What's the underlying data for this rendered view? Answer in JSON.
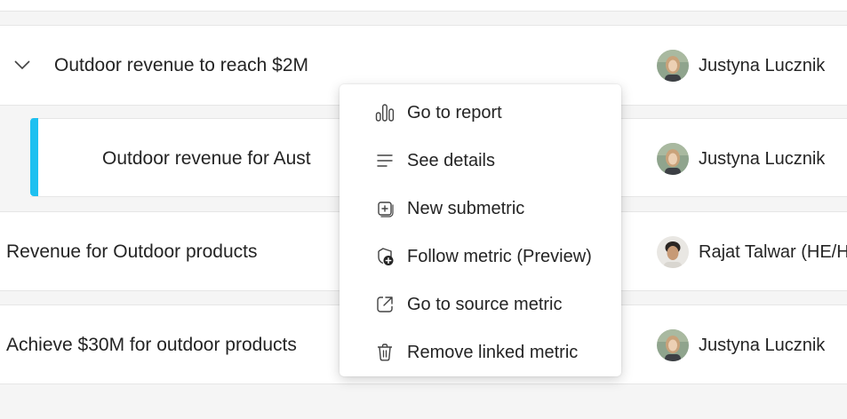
{
  "metrics": [
    {
      "name": "Outdoor revenue to reach $2M",
      "owner": "Justyna Lucznik",
      "expanded": true
    },
    {
      "name": "Outdoor revenue for Aust",
      "owner": "Justyna Lucznik"
    },
    {
      "name": "Revenue for Outdoor products",
      "owner": "Rajat Talwar (HE/H"
    },
    {
      "name": "Achieve $30M for outdoor products",
      "owner": "Justyna Lucznik"
    }
  ],
  "context_menu": {
    "items": [
      {
        "label": "Go to report",
        "icon": "bar-chart-icon"
      },
      {
        "label": "See details",
        "icon": "text-lines-icon"
      },
      {
        "label": "New submetric",
        "icon": "add-square-icon"
      },
      {
        "label": "Follow metric (Preview)",
        "icon": "follow-icon"
      },
      {
        "label": "Go to source metric",
        "icon": "open-external-icon"
      },
      {
        "label": "Remove linked metric",
        "icon": "trash-icon"
      }
    ]
  },
  "colors": {
    "accent": "#1ec0f0",
    "background": "#f5f5f5",
    "row": "#ffffff"
  }
}
